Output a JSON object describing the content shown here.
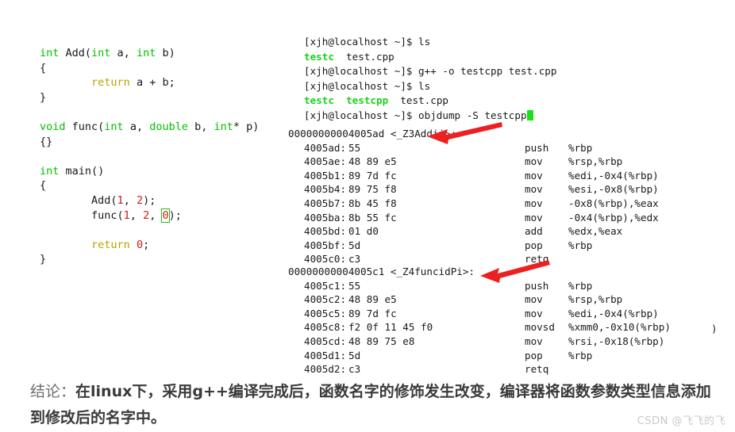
{
  "editor": {
    "lines": [
      [
        {
          "t": "int",
          "c": "kw"
        },
        {
          "t": " Add(",
          "c": "plain"
        },
        {
          "t": "int",
          "c": "kw"
        },
        {
          "t": " a, ",
          "c": "plain"
        },
        {
          "t": "int",
          "c": "kw"
        },
        {
          "t": " b)",
          "c": "plain"
        }
      ],
      [
        {
          "t": "{",
          "c": "plain"
        }
      ],
      [
        {
          "t": "        ",
          "c": "plain"
        },
        {
          "t": "return",
          "c": "ret"
        },
        {
          "t": " a + b;",
          "c": "plain"
        }
      ],
      [
        {
          "t": "}",
          "c": "plain"
        }
      ],
      [
        {
          "t": " ",
          "c": "plain"
        }
      ],
      [
        {
          "t": "void",
          "c": "kw"
        },
        {
          "t": " func(",
          "c": "plain"
        },
        {
          "t": "int",
          "c": "kw"
        },
        {
          "t": " a, ",
          "c": "plain"
        },
        {
          "t": "double",
          "c": "kw"
        },
        {
          "t": " b, ",
          "c": "plain"
        },
        {
          "t": "int",
          "c": "kw"
        },
        {
          "t": "* p)",
          "c": "plain"
        }
      ],
      [
        {
          "t": "{}",
          "c": "plain"
        }
      ],
      [
        {
          "t": " ",
          "c": "plain"
        }
      ],
      [
        {
          "t": "int",
          "c": "kw"
        },
        {
          "t": " main()",
          "c": "plain"
        }
      ],
      [
        {
          "t": "{",
          "c": "plain"
        }
      ],
      [
        {
          "t": "        Add(",
          "c": "plain"
        },
        {
          "t": "1",
          "c": "num"
        },
        {
          "t": ", ",
          "c": "plain"
        },
        {
          "t": "2",
          "c": "num"
        },
        {
          "t": ");",
          "c": "plain"
        }
      ],
      [
        {
          "t": "        func(",
          "c": "plain"
        },
        {
          "t": "1",
          "c": "num"
        },
        {
          "t": ", ",
          "c": "plain"
        },
        {
          "t": "2",
          "c": "num"
        },
        {
          "t": ", ",
          "c": "plain"
        },
        {
          "t": "0",
          "c": "boxed"
        },
        {
          "t": ");",
          "c": "plain"
        }
      ],
      [
        {
          "t": " ",
          "c": "plain"
        }
      ],
      [
        {
          "t": "        ",
          "c": "plain"
        },
        {
          "t": "return",
          "c": "ret"
        },
        {
          "t": " ",
          "c": "plain"
        },
        {
          "t": "0",
          "c": "num"
        },
        {
          "t": ";",
          "c": "plain"
        }
      ],
      [
        {
          "t": "}",
          "c": "plain"
        }
      ]
    ]
  },
  "terminal": {
    "prompt": "[xjh@localhost ~]$ ",
    "lines": [
      [
        {
          "t": "[xjh@localhost ~]$ ls",
          "c": "plain"
        }
      ],
      [
        {
          "t": "testc",
          "c": "g"
        },
        {
          "t": "  test.cpp",
          "c": "plain"
        }
      ],
      [
        {
          "t": "[xjh@localhost ~]$ g++ -o testcpp test.cpp",
          "c": "plain"
        }
      ],
      [
        {
          "t": "[xjh@localhost ~]$ ls",
          "c": "plain"
        }
      ],
      [
        {
          "t": "testc",
          "c": "g"
        },
        {
          "t": "  ",
          "c": "plain"
        },
        {
          "t": "testcpp",
          "c": "g"
        },
        {
          "t": "  test.cpp",
          "c": "plain"
        }
      ],
      [
        {
          "t": "[xjh@localhost ~]$ objdump -S testcpp",
          "c": "plain"
        },
        {
          "t": "",
          "c": "cursor"
        }
      ]
    ]
  },
  "disassembly": [
    {
      "header": "00000000004005ad <_Z3Addii>:",
      "rows": [
        {
          "addr": "4005ad:",
          "bytes": "55",
          "mn": "push",
          "op": "%rbp"
        },
        {
          "addr": "4005ae:",
          "bytes": "48 89 e5",
          "mn": "mov",
          "op": "%rsp,%rbp"
        },
        {
          "addr": "4005b1:",
          "bytes": "89 7d fc",
          "mn": "mov",
          "op": "%edi,-0x4(%rbp)"
        },
        {
          "addr": "4005b4:",
          "bytes": "89 75 f8",
          "mn": "mov",
          "op": "%esi,-0x8(%rbp)"
        },
        {
          "addr": "4005b7:",
          "bytes": "8b 45 f8",
          "mn": "mov",
          "op": "-0x8(%rbp),%eax"
        },
        {
          "addr": "4005ba:",
          "bytes": "8b 55 fc",
          "mn": "mov",
          "op": "-0x4(%rbp),%edx"
        },
        {
          "addr": "4005bd:",
          "bytes": "01 d0",
          "mn": "add",
          "op": "%edx,%eax"
        },
        {
          "addr": "4005bf:",
          "bytes": "5d",
          "mn": "pop",
          "op": "%rbp"
        },
        {
          "addr": "4005c0:",
          "bytes": "c3",
          "mn": "retq",
          "op": ""
        }
      ]
    },
    {
      "header": "00000000004005c1 <_Z4funcidPi>:",
      "rows": [
        {
          "addr": "4005c1:",
          "bytes": "55",
          "mn": "push",
          "op": "%rbp"
        },
        {
          "addr": "4005c2:",
          "bytes": "48 89 e5",
          "mn": "mov",
          "op": "%rsp,%rbp"
        },
        {
          "addr": "4005c5:",
          "bytes": "89 7d fc",
          "mn": "mov",
          "op": "%edi,-0x4(%rbp)"
        },
        {
          "addr": "4005c8:",
          "bytes": "f2 0f 11 45 f0",
          "mn": "movsd",
          "op": "%xmm0,-0x10(%rbp)",
          "extra": ")"
        },
        {
          "addr": "4005cd:",
          "bytes": "48 89 75 e8",
          "mn": "mov",
          "op": "%rsi,-0x18(%rbp)"
        },
        {
          "addr": "4005d1:",
          "bytes": "5d",
          "mn": "pop",
          "op": "%rbp"
        },
        {
          "addr": "4005d2:",
          "bytes": "c3",
          "mn": "retq",
          "op": ""
        }
      ]
    }
  ],
  "annotations": {
    "arrow1_name": "red-arrow-to-Z3Addii",
    "arrow2_name": "red-arrow-to-Z4funcidPi",
    "arrow_color": "#ec2020"
  },
  "conclusion": {
    "label": "结论：",
    "body": "在linux下，采用g++编译完成后，函数名字的修饰发生改变，编译器将函数参数类型信息添加到修改后的名字中。"
  },
  "watermark": {
    "text": "CSDN @飞飞的飞"
  },
  "colors": {
    "keyword_green": "#00c000",
    "return_yellow": "#b8a300",
    "number_red": "#d21a1a",
    "terminal_green": "#19d219",
    "arrow_red": "#ec2020",
    "background": "#ffffff"
  }
}
